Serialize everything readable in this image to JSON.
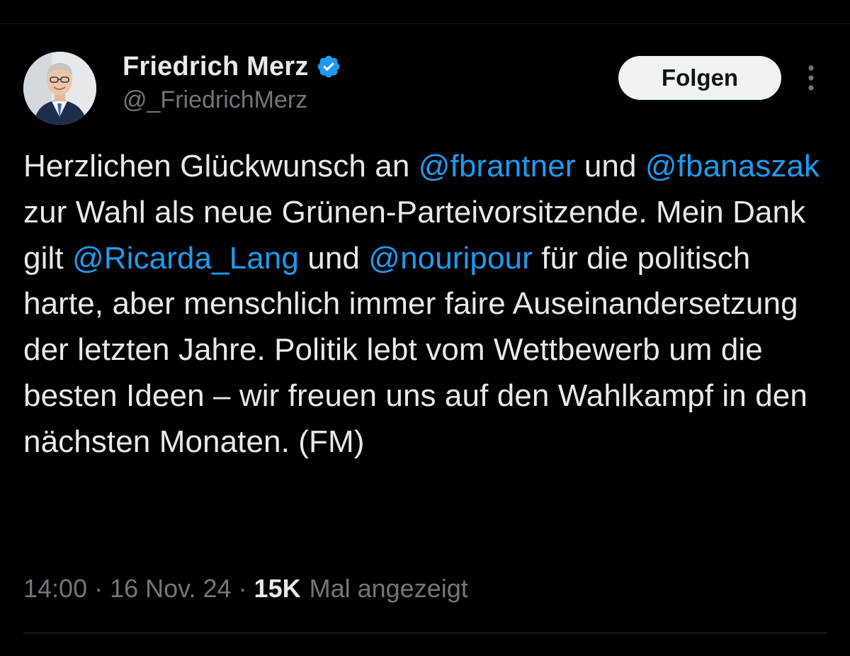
{
  "author": {
    "display_name": "Friedrich Merz",
    "handle": "@_FriedrichMerz",
    "verified": true,
    "avatar_icon": "person-portrait-avatar"
  },
  "actions": {
    "follow_label": "Folgen",
    "more_icon": "vertical-ellipsis-icon"
  },
  "tweet": {
    "segments": [
      {
        "type": "text",
        "text": "Herzlichen Glückwunsch an "
      },
      {
        "type": "mention",
        "text": "@fbrantner"
      },
      {
        "type": "text",
        "text": " und "
      },
      {
        "type": "mention",
        "text": "@fbanaszak"
      },
      {
        "type": "text",
        "text": " zur Wahl als neue Grünen-Parteivorsitzende. Mein Dank gilt "
      },
      {
        "type": "mention",
        "text": "@Ricarda_Lang"
      },
      {
        "type": "text",
        "text": " und "
      },
      {
        "type": "mention",
        "text": "@nouripour"
      },
      {
        "type": "text",
        "text": " für die politisch harte, aber menschlich immer faire Auseinandersetzung der letzten Jahre. Politik lebt vom Wettbewerb um die besten Ideen – wir freuen uns auf den Wahlkampf in den nächsten Monaten. (FM)"
      }
    ]
  },
  "meta": {
    "time": "14:00",
    "date": "16 Nov. 24",
    "separator": "·",
    "views_count": "15K",
    "views_label": "Mal angezeigt"
  },
  "colors": {
    "background": "#000000",
    "text": "#e7e9ea",
    "secondary_text": "#71767b",
    "mention": "#1d9bf0",
    "verified_badge": "#1d9bf0",
    "follow_button_bg": "#eff3f4",
    "follow_button_text": "#0f1419"
  }
}
